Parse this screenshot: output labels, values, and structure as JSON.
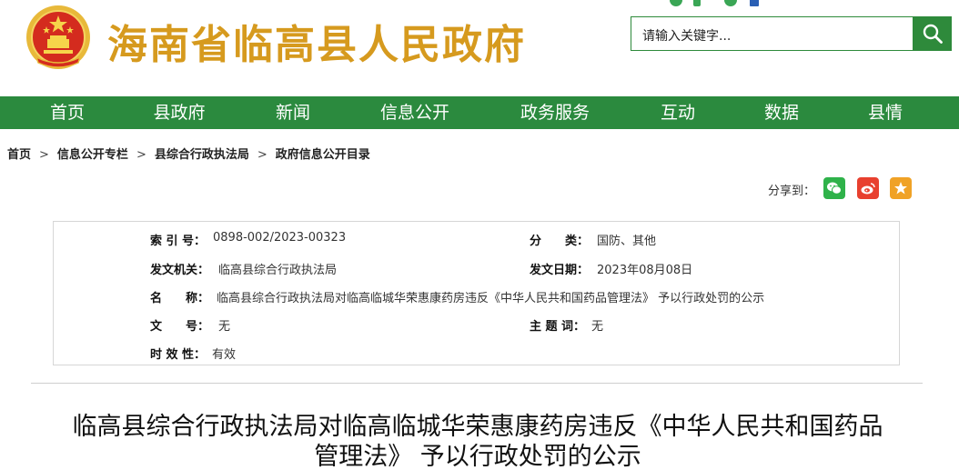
{
  "header": {
    "site_title": "海南省临高县人民政府",
    "search_placeholder": "请输入关键字...",
    "colors": {
      "title": "#d69a1e",
      "brand_green": "#2b8a3e"
    }
  },
  "nav": {
    "items": [
      "首页",
      "县政府",
      "新闻",
      "信息公开",
      "政务服务",
      "互动",
      "数据",
      "县情"
    ]
  },
  "breadcrumb": {
    "items": [
      "首页",
      "信息公开专栏",
      "县综合行政执法局",
      "政府信息公开目录"
    ],
    "separator": ">"
  },
  "share": {
    "label": "分享到：",
    "targets": [
      "wechat-icon",
      "weibo-icon",
      "favorite-star-icon"
    ]
  },
  "info": {
    "index_label": "索 引 号：",
    "index_value": "0898-002/2023-00323",
    "category_label": "分　　类：",
    "category_value": "国防、其他",
    "issuer_label": "发文机关：",
    "issuer_value": "临高县综合行政执法局",
    "date_label": "发文日期：",
    "date_value": "2023年08月08日",
    "name_label": "名　　称：",
    "name_value": "临高县综合行政执法局对临高临城华荣惠康药房违反《中华人民共和国药品管理法》 予以行政处罚的公示",
    "docno_label": "文　　号：",
    "docno_value": "无",
    "subject_label": "主 题 词：",
    "subject_value": "无",
    "validity_label": "时 效 性：",
    "validity_value": "有效"
  },
  "article": {
    "title_line1": "临高县综合行政执法局对临高临城华荣惠康药房违反《中华人民共和国药品",
    "title_line2": "管理法》 予以行政处罚的公示"
  }
}
